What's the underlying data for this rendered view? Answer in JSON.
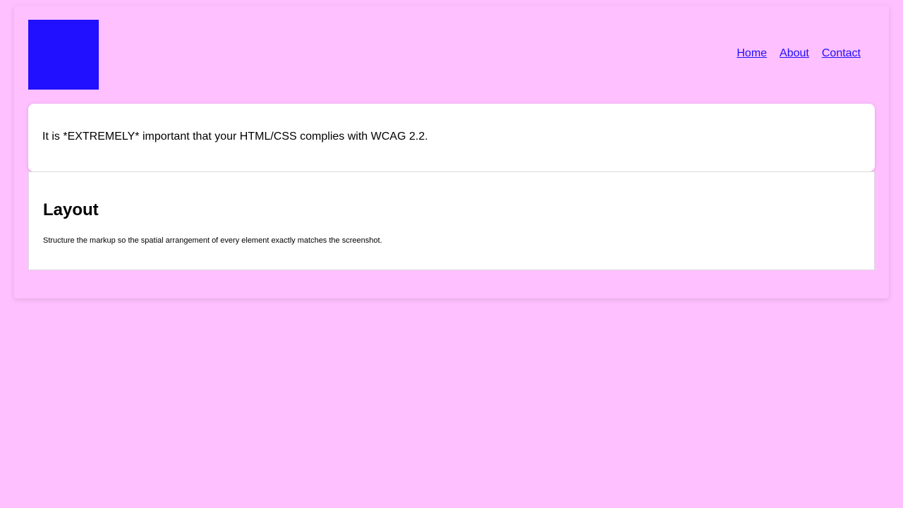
{
  "header": {
    "logo_color": "#2010ff",
    "nav": {
      "home": "Home",
      "about": "About",
      "contact": "Contact"
    }
  },
  "notice": {
    "text": "It is *EXTREMELY* important that your HTML/CSS complies with WCAG 2.2."
  },
  "layout_section": {
    "title": "Layout",
    "description": "Structure the markup so the spatial arrangement of every element exactly matches the screenshot."
  },
  "colors": {
    "background": "#ffc0ff",
    "link": "#2010ff",
    "card": "#ffffff"
  }
}
